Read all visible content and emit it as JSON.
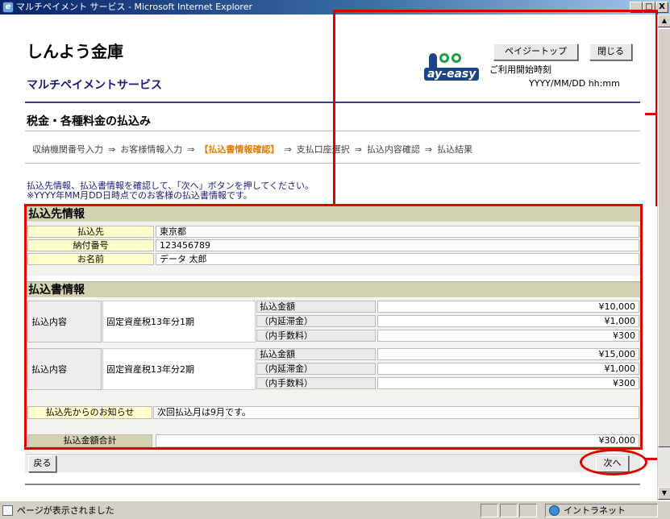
{
  "window": {
    "title": "マルチペイメント サービス - Microsoft Internet Explorer",
    "min": "_",
    "max": "□",
    "close": "X"
  },
  "header": {
    "bank_name": "しんよう金庫",
    "service_name": "マルチペイメントサービス",
    "logo_text": "ay-easy",
    "page_top_button": "ペイジートップ",
    "close_button": "閉じる",
    "usage_label": "ご利用開始時刻",
    "usage_time": "YYYY/MM/DD hh:mm"
  },
  "page_title": "税金・各種料金の払込み",
  "steps": [
    {
      "label": "収納機関番号入力"
    },
    {
      "label": "お客様情報入力"
    },
    {
      "label": "【払込書情報確認】"
    },
    {
      "label": "支払口座選択"
    },
    {
      "label": "払込内容確認"
    },
    {
      "label": "払込結果"
    }
  ],
  "step_arrow": "⇒",
  "instructions": {
    "line1": "払込先情報、払込書情報を確認して、「次へ」ボタンを押してください。",
    "line2": "※YYYY年MM月DD日時点でのお客様の払込書情報です。"
  },
  "payee_section": {
    "title": "払込先情報",
    "rows": [
      {
        "label": "払込先",
        "value": "東京都"
      },
      {
        "label": "納付番号",
        "value": "123456789"
      },
      {
        "label": "お名前",
        "value": "データ 太郎"
      }
    ]
  },
  "bill_section": {
    "title": "払込書情報",
    "items": [
      {
        "label": "払込内容",
        "description": "固定資産税13年分1期",
        "lines": [
          {
            "label": "払込金額",
            "amount": "¥10,000"
          },
          {
            "label": "（内延滞金）",
            "amount": "¥1,000"
          },
          {
            "label": "（内手数料）",
            "amount": "¥300"
          }
        ]
      },
      {
        "label": "払込内容",
        "description": "固定資産税13年分2期",
        "lines": [
          {
            "label": "払込金額",
            "amount": "¥15,000"
          },
          {
            "label": "（内延滞金）",
            "amount": "¥1,000"
          },
          {
            "label": "（内手数料）",
            "amount": "¥300"
          }
        ]
      }
    ],
    "notice_label": "払込先からのお知らせ",
    "notice_value": "次回払込月は9月です。",
    "total_label": "払込金額合計",
    "total_value": "¥30,000"
  },
  "footer": {
    "back_button": "戻る",
    "next_button": "次へ"
  },
  "statusbar": {
    "message": "ページが表示されました",
    "zone": "イントラネット"
  },
  "colors": {
    "annotation": "#e00000",
    "section_header": "#d2d2b0",
    "current_step": "#e57a00"
  }
}
